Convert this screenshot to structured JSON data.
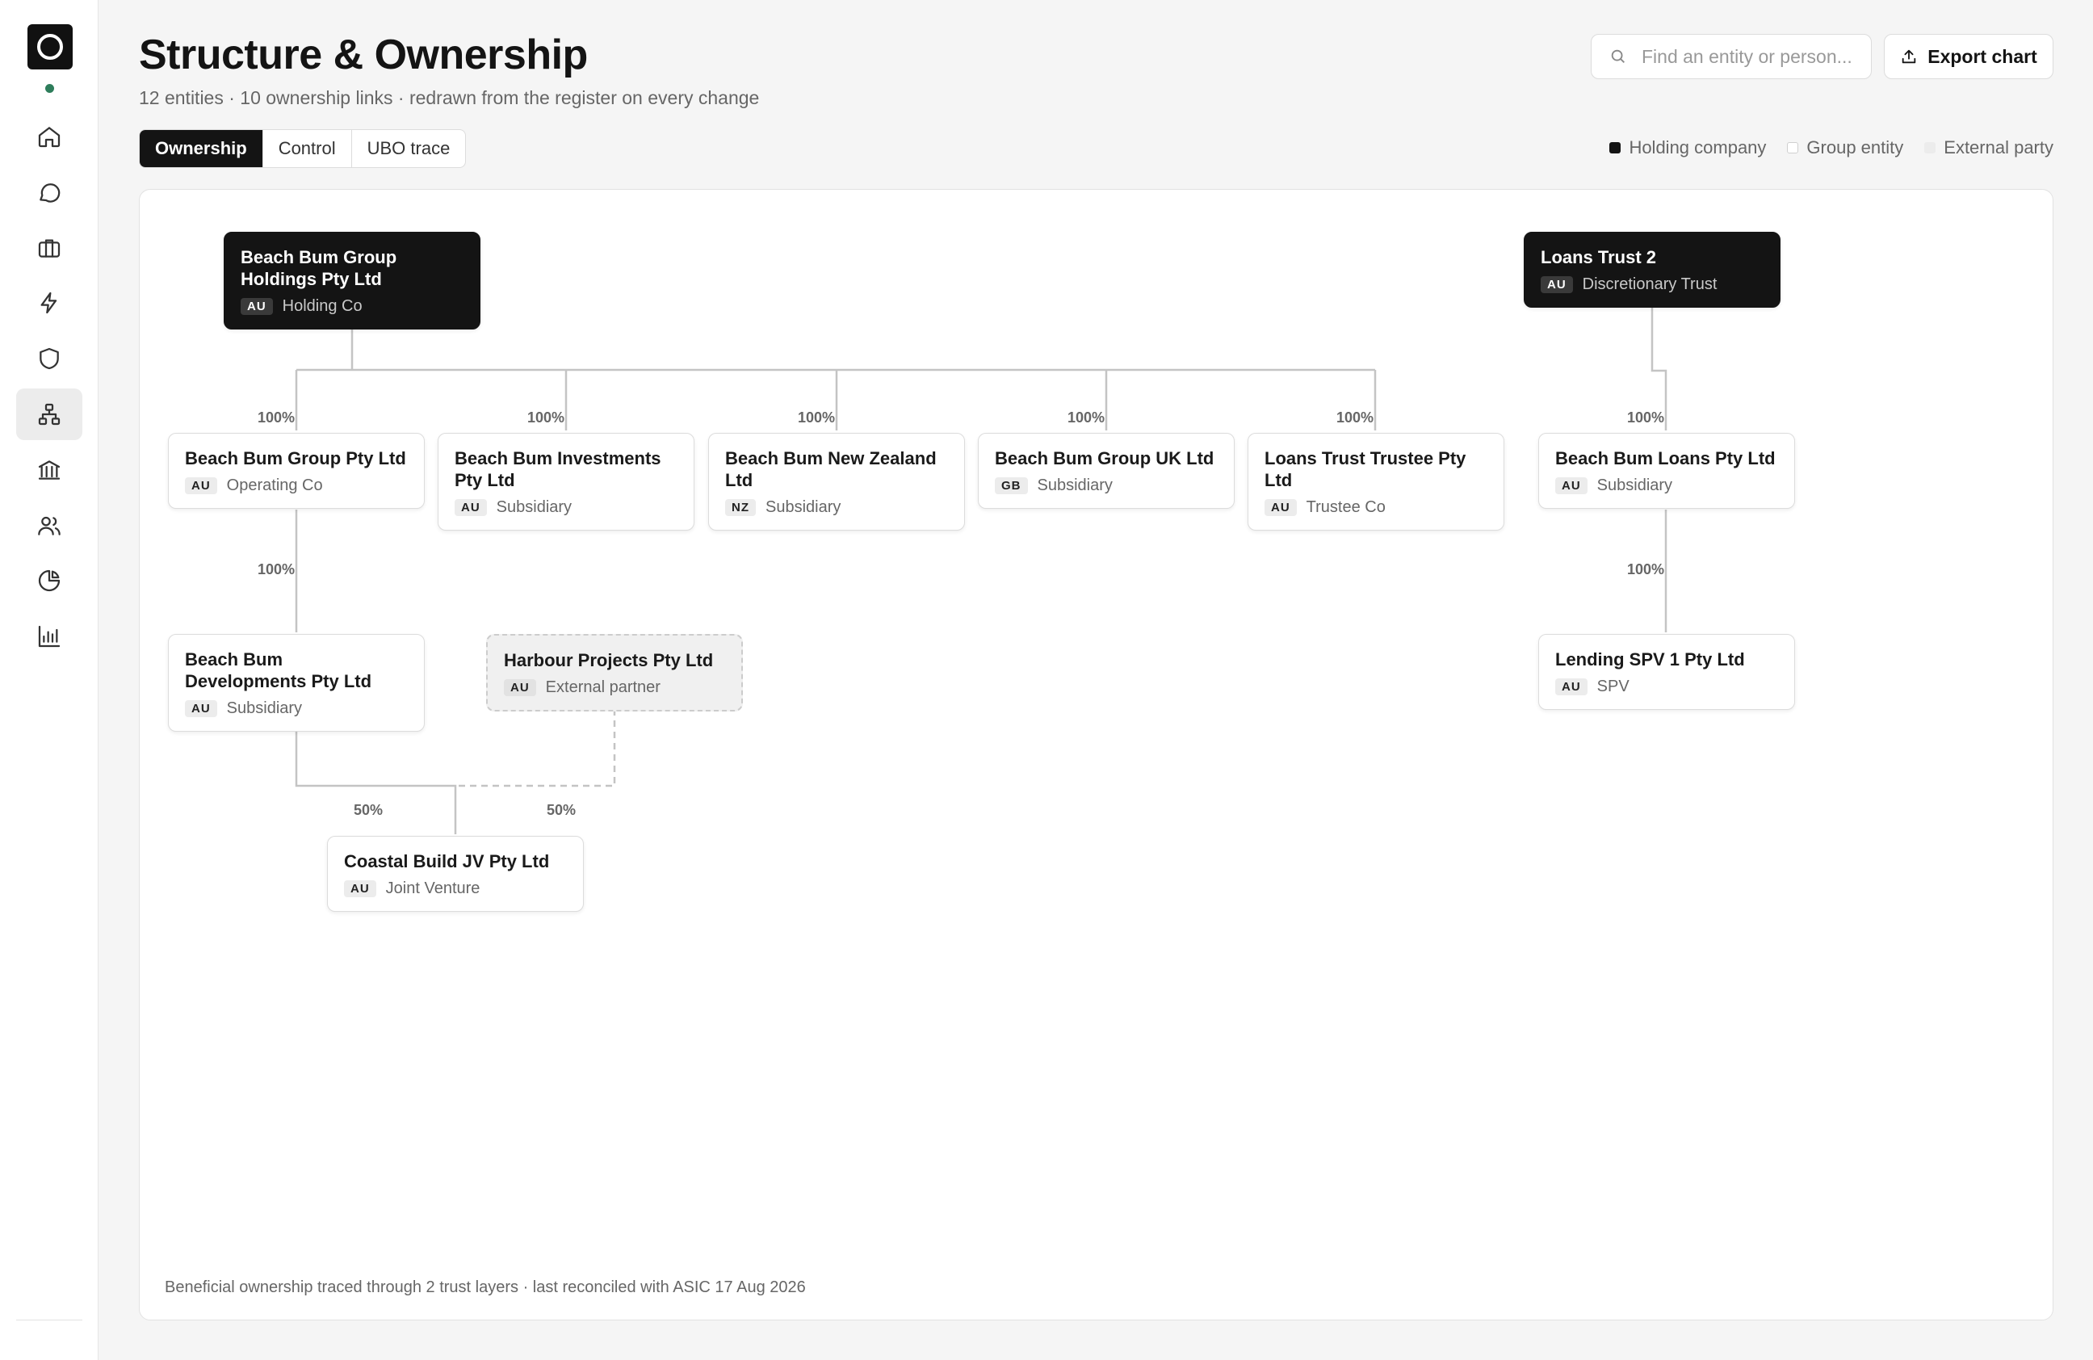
{
  "nav": {
    "items": [
      {
        "name": "home",
        "icon": "home-icon",
        "active": false
      },
      {
        "name": "messages",
        "icon": "chat-bubble-icon",
        "active": false
      },
      {
        "name": "portfolio",
        "icon": "briefcase-icon",
        "active": false
      },
      {
        "name": "activity",
        "icon": "lightning-icon",
        "active": false
      },
      {
        "name": "compliance",
        "icon": "shield-icon",
        "active": false
      },
      {
        "name": "structure",
        "icon": "org-chart-icon",
        "active": true
      },
      {
        "name": "banking",
        "icon": "bank-icon",
        "active": false
      },
      {
        "name": "people",
        "icon": "users-icon",
        "active": false
      },
      {
        "name": "allocation",
        "icon": "pie-chart-icon",
        "active": false
      },
      {
        "name": "reports",
        "icon": "bar-chart-icon",
        "active": false
      }
    ],
    "status_color": "#2e7d5b"
  },
  "header": {
    "title": "Structure & Ownership",
    "subtitle": "12 entities · 10 ownership links · redrawn from the register on every change",
    "search_placeholder": "Find an entity or person...",
    "export_label": "Export chart"
  },
  "tabs": [
    {
      "label": "Ownership",
      "active": true
    },
    {
      "label": "Control",
      "active": false
    },
    {
      "label": "UBO trace",
      "active": false
    }
  ],
  "legend": {
    "holding": "Holding company",
    "group": "Group entity",
    "external": "External party"
  },
  "entities": {
    "bbgh": {
      "name": "Beach Bum Group Holdings Pty Ltd",
      "jurisdiction": "AU",
      "role": "Holding Co",
      "kind": "holding"
    },
    "lt2": {
      "name": "Loans Trust 2",
      "jurisdiction": "AU",
      "role": "Discretionary Trust",
      "kind": "holding"
    },
    "bbg": {
      "name": "Beach Bum Group Pty Ltd",
      "jurisdiction": "AU",
      "role": "Operating Co",
      "kind": "group"
    },
    "bbi": {
      "name": "Beach Bum Investments Pty Ltd",
      "jurisdiction": "AU",
      "role": "Subsidiary",
      "kind": "group"
    },
    "bbnz": {
      "name": "Beach Bum New Zealand Ltd",
      "jurisdiction": "NZ",
      "role": "Subsidiary",
      "kind": "group"
    },
    "bbuk": {
      "name": "Beach Bum Group UK Ltd",
      "jurisdiction": "GB",
      "role": "Subsidiary",
      "kind": "group"
    },
    "ltt": {
      "name": "Loans Trust Trustee Pty Ltd",
      "jurisdiction": "AU",
      "role": "Trustee Co",
      "kind": "group"
    },
    "bbl": {
      "name": "Beach Bum Loans Pty Ltd",
      "jurisdiction": "AU",
      "role": "Subsidiary",
      "kind": "group"
    },
    "bbd": {
      "name": "Beach Bum Developments Pty Ltd",
      "jurisdiction": "AU",
      "role": "Subsidiary",
      "kind": "group"
    },
    "hp": {
      "name": "Harbour Projects Pty Ltd",
      "jurisdiction": "AU",
      "role": "External partner",
      "kind": "external"
    },
    "spv": {
      "name": "Lending SPV 1 Pty Ltd",
      "jurisdiction": "AU",
      "role": "SPV",
      "kind": "group"
    },
    "cb": {
      "name": "Coastal Build JV Pty Ltd",
      "jurisdiction": "AU",
      "role": "Joint Venture",
      "kind": "group"
    }
  },
  "links": {
    "bbgh_bbg": "100%",
    "bbgh_bbi": "100%",
    "bbgh_bbnz": "100%",
    "bbgh_bbuk": "100%",
    "bbgh_ltt": "100%",
    "lt2_bbl": "100%",
    "bbg_bbd": "100%",
    "bbl_spv": "100%",
    "bbd_cb": "50%",
    "hp_cb": "50%"
  },
  "footer_note": "Beneficial ownership traced through 2 trust layers · last reconciled with ASIC 17 Aug 2026"
}
